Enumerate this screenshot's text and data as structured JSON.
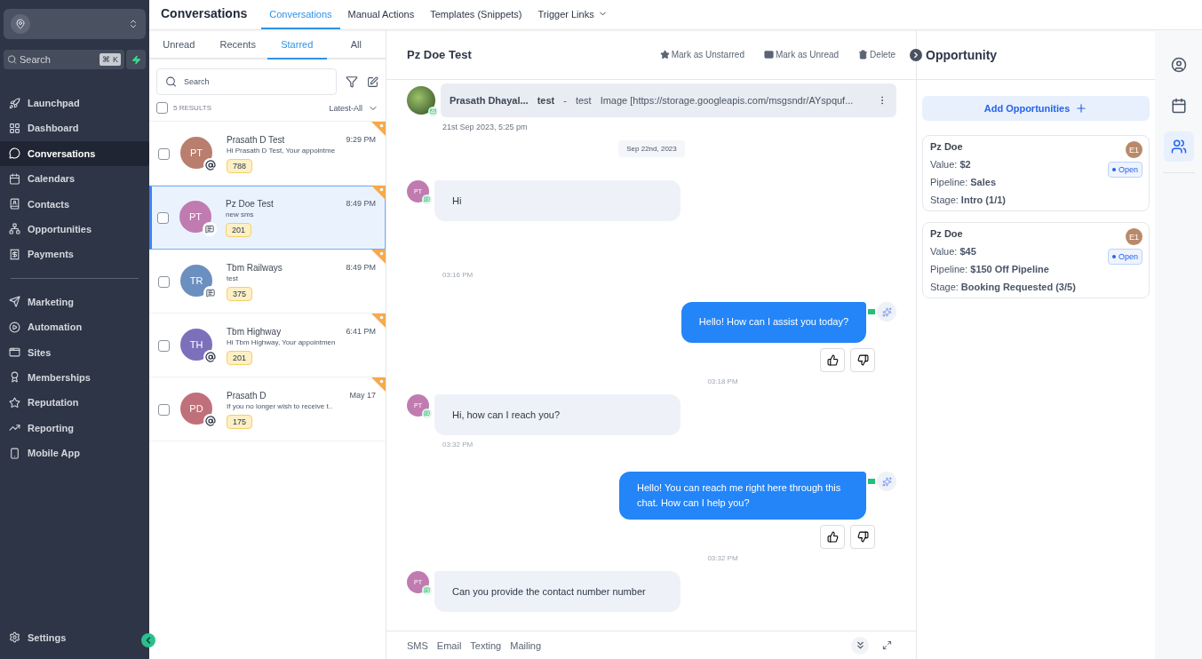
{
  "sidebar": {
    "search": {
      "placeholder": "Search",
      "shortcut": "⌘ K"
    },
    "primary_items": [
      {
        "label": "Launchpad",
        "selected": false
      },
      {
        "label": "Dashboard",
        "selected": false
      },
      {
        "label": "Conversations",
        "selected": true
      },
      {
        "label": "Calendars",
        "selected": false
      },
      {
        "label": "Contacts",
        "selected": false
      },
      {
        "label": "Opportunities",
        "selected": false
      },
      {
        "label": "Payments",
        "selected": false
      }
    ],
    "secondary_items": [
      {
        "label": "Marketing",
        "selected": false
      },
      {
        "label": "Automation",
        "selected": false
      },
      {
        "label": "Sites",
        "selected": false
      },
      {
        "label": "Memberships",
        "selected": false
      },
      {
        "label": "Reputation",
        "selected": false
      },
      {
        "label": "Reporting",
        "selected": false
      },
      {
        "label": "Mobile App",
        "selected": false
      }
    ],
    "settings": {
      "label": "Settings"
    }
  },
  "header": {
    "title": "Conversations",
    "tabs": [
      {
        "label": "Conversations",
        "selected": true,
        "kind": "link"
      },
      {
        "label": "Manual Actions",
        "selected": false,
        "kind": "link"
      },
      {
        "label": "Templates (Snippets)",
        "selected": false,
        "kind": "link"
      },
      {
        "label": "Trigger Links",
        "selected": false,
        "kind": "dropdown"
      }
    ]
  },
  "conversation_list": {
    "filter_tabs": [
      {
        "label": "Unread",
        "selected": false
      },
      {
        "label": "Recents",
        "selected": false
      },
      {
        "label": "Starred",
        "selected": true
      },
      {
        "label": "All",
        "selected": false
      }
    ],
    "search": {
      "placeholder": "Search"
    },
    "results": "5 RESULTS",
    "select_all": {
      "checked": false
    },
    "sort": "Latest-All",
    "items": [
      {
        "initials": "PT",
        "color": "#b97e6e",
        "kind": "email",
        "name": "Prasath D Test",
        "time": "9:29 PM",
        "preview": "Hi Prasath D Test, Your appointme",
        "count": "788",
        "selected": false,
        "checked": false,
        "starred": true
      },
      {
        "initials": "PT",
        "color": "#c07bb0",
        "kind": "sms",
        "name": "Pz Doe Test",
        "time": "8:49 PM",
        "preview": "new sms",
        "count": "201",
        "selected": true,
        "checked": false,
        "starred": true
      },
      {
        "initials": "TR",
        "color": "#6b8fbf",
        "kind": "sms",
        "name": "Tbm Railways",
        "time": "8:49 PM",
        "preview": "test",
        "count": "375",
        "selected": false,
        "checked": false,
        "starred": true
      },
      {
        "initials": "TH",
        "color": "#7d70bb",
        "kind": "email",
        "name": "Tbm Highway",
        "time": "6:41 PM",
        "preview": "Hi Tbm Highway, Your appointmen",
        "count": "201",
        "selected": false,
        "checked": false,
        "starred": true
      },
      {
        "initials": "PD",
        "color": "#c0707a",
        "kind": "email",
        "name": "Prasath D",
        "time": "May 17",
        "preview": "If you no longer wish to receive t..",
        "count": "175",
        "selected": false,
        "checked": false,
        "starred": true
      }
    ]
  },
  "chat": {
    "title": "Pz Doe Test",
    "actions": [
      {
        "label": "Mark as Unstarred",
        "kind": "star"
      },
      {
        "label": "Mark as Unread",
        "kind": "mail"
      },
      {
        "label": "Delete",
        "kind": "trash"
      }
    ],
    "messages": [
      {
        "kind": "email",
        "sender": "Prasath Dhayal...",
        "subject": "test",
        "separator": "-",
        "body": "test",
        "attachment": "Image [https://storage.googleapis.com/msgsndr/AYspquf...",
        "time": "21st Sep 2023, 5:25 pm"
      },
      {
        "kind": "date",
        "text": "Sep 22nd, 2023"
      },
      {
        "kind": "inbound",
        "initials": "PT",
        "text": "Hi",
        "time": "03:16 PM"
      },
      {
        "kind": "outbound",
        "text": "Hello! How can I assist you today?",
        "time": "03:18 PM"
      },
      {
        "kind": "inbound",
        "initials": "PT",
        "text": "Hi, how can I reach you?",
        "time": "03:32 PM"
      },
      {
        "kind": "outbound",
        "text": "Hello! You can reach me right here through this chat. How can I help you?",
        "time": "03:32 PM"
      },
      {
        "kind": "inbound",
        "initials": "PT",
        "text": "Can you provide the contact number number"
      }
    ],
    "composer_tabs": [
      "SMS",
      "Email",
      "Texting",
      "Mailing"
    ]
  },
  "opportunity": {
    "title": "Opportunity",
    "add_button": "Add Opportunities",
    "cards": [
      {
        "name": "Pz Doe",
        "owner": "E1",
        "status": "Open",
        "lines": [
          "Value: **$2**",
          "Pipeline: **Sales**",
          "Stage:  **Intro (1/1)**"
        ]
      },
      {
        "name": "Pz Doe",
        "owner": "E1",
        "status": "Open",
        "lines": [
          "Value: **$45**",
          "Pipeline: **$150 Off Pipeline**",
          "Stage:  **Booking Requested (3/5)**"
        ]
      }
    ]
  },
  "right_rail": [
    {
      "selected": false
    },
    {
      "selected": false
    },
    {
      "selected": true
    }
  ]
}
